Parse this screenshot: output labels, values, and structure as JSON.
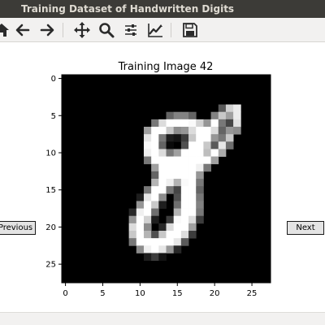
{
  "window": {
    "title": "Training Dataset of Handwritten Digits"
  },
  "toolbar": {
    "buttons": [
      {
        "name": "home-icon"
      },
      {
        "name": "back-arrow-icon"
      },
      {
        "name": "forward-arrow-icon"
      },
      {
        "name": "pan-move-icon"
      },
      {
        "name": "zoom-magnifier-icon"
      },
      {
        "name": "subplots-config-icon"
      },
      {
        "name": "edit-axes-icon"
      },
      {
        "name": "save-icon"
      }
    ]
  },
  "navigation": {
    "previous_label": "Previous",
    "next_label": "Next"
  },
  "chart_data": {
    "type": "heatmap",
    "title": "Training Image 42",
    "colormap": "gray",
    "x_ticks": [
      0,
      5,
      10,
      15,
      20,
      25
    ],
    "y_ticks": [
      0,
      5,
      10,
      15,
      20,
      25
    ],
    "xlim": [
      -0.5,
      27.5
    ],
    "ylim": [
      27.5,
      -0.5
    ],
    "grid": false,
    "pixels": [
      [
        0,
        0,
        0,
        0,
        0,
        0,
        0,
        0,
        0,
        0,
        0,
        0,
        0,
        0,
        0,
        0,
        0,
        0,
        0,
        0,
        0,
        0,
        0,
        0,
        0,
        0,
        0,
        0
      ],
      [
        0,
        0,
        0,
        0,
        0,
        0,
        0,
        0,
        0,
        0,
        0,
        0,
        0,
        0,
        0,
        0,
        0,
        0,
        0,
        0,
        0,
        0,
        0,
        0,
        0,
        0,
        0,
        0
      ],
      [
        0,
        0,
        0,
        0,
        0,
        0,
        0,
        0,
        0,
        0,
        0,
        0,
        0,
        0,
        0,
        0,
        0,
        0,
        0,
        0,
        0,
        0,
        0,
        0,
        0,
        0,
        0,
        0
      ],
      [
        0,
        0,
        0,
        0,
        0,
        0,
        0,
        0,
        0,
        0,
        0,
        0,
        0,
        0,
        0,
        0,
        0,
        0,
        0,
        0,
        0,
        0,
        0,
        0,
        0,
        0,
        0,
        0
      ],
      [
        0,
        0,
        0,
        0,
        0,
        0,
        0,
        0,
        0,
        0,
        0,
        0,
        0,
        0,
        0,
        0,
        0,
        0,
        0,
        0,
        0,
        90,
        210,
        235,
        0,
        0,
        0,
        0
      ],
      [
        0,
        0,
        0,
        0,
        0,
        0,
        0,
        0,
        0,
        0,
        0,
        0,
        0,
        0,
        100,
        130,
        130,
        100,
        0,
        0,
        130,
        200,
        160,
        235,
        0,
        0,
        0,
        0
      ],
      [
        0,
        0,
        0,
        0,
        0,
        0,
        0,
        0,
        0,
        0,
        0,
        0,
        120,
        220,
        255,
        255,
        255,
        250,
        210,
        150,
        255,
        120,
        70,
        225,
        0,
        0,
        0,
        0
      ],
      [
        0,
        0,
        0,
        0,
        0,
        0,
        0,
        0,
        0,
        0,
        0,
        160,
        255,
        255,
        200,
        140,
        150,
        220,
        255,
        255,
        220,
        100,
        150,
        140,
        0,
        0,
        0,
        0
      ],
      [
        0,
        0,
        0,
        0,
        0,
        0,
        0,
        0,
        0,
        0,
        0,
        230,
        255,
        120,
        30,
        20,
        60,
        200,
        255,
        255,
        150,
        120,
        200,
        0,
        0,
        0,
        0,
        0
      ],
      [
        0,
        0,
        0,
        0,
        0,
        0,
        0,
        0,
        0,
        0,
        0,
        250,
        255,
        100,
        10,
        0,
        80,
        255,
        255,
        200,
        90,
        230,
        110,
        0,
        0,
        0,
        0,
        0
      ],
      [
        0,
        0,
        0,
        0,
        0,
        0,
        0,
        0,
        0,
        0,
        0,
        240,
        255,
        220,
        120,
        160,
        255,
        255,
        255,
        190,
        255,
        170,
        0,
        0,
        0,
        0,
        0,
        0
      ],
      [
        0,
        0,
        0,
        0,
        0,
        0,
        0,
        0,
        0,
        0,
        0,
        120,
        255,
        255,
        255,
        255,
        255,
        255,
        255,
        255,
        160,
        0,
        0,
        0,
        0,
        0,
        0,
        0
      ],
      [
        0,
        0,
        0,
        0,
        0,
        0,
        0,
        0,
        0,
        0,
        0,
        0,
        160,
        255,
        255,
        255,
        255,
        255,
        240,
        120,
        0,
        0,
        0,
        0,
        0,
        0,
        0,
        0
      ],
      [
        0,
        0,
        0,
        0,
        0,
        0,
        0,
        0,
        0,
        0,
        0,
        0,
        100,
        255,
        255,
        255,
        255,
        255,
        150,
        0,
        0,
        0,
        0,
        0,
        0,
        0,
        0,
        0
      ],
      [
        0,
        0,
        0,
        0,
        0,
        0,
        0,
        0,
        0,
        0,
        0,
        0,
        180,
        255,
        240,
        180,
        250,
        255,
        120,
        0,
        0,
        0,
        0,
        0,
        0,
        0,
        0,
        0
      ],
      [
        0,
        0,
        0,
        0,
        0,
        0,
        0,
        0,
        0,
        0,
        0,
        120,
        255,
        255,
        120,
        70,
        255,
        255,
        100,
        0,
        0,
        0,
        0,
        0,
        0,
        0,
        0,
        0
      ],
      [
        0,
        0,
        0,
        0,
        0,
        0,
        0,
        0,
        0,
        0,
        30,
        230,
        255,
        140,
        0,
        80,
        255,
        255,
        120,
        0,
        0,
        0,
        0,
        0,
        0,
        0,
        0,
        0
      ],
      [
        0,
        0,
        0,
        0,
        0,
        0,
        0,
        0,
        0,
        0,
        150,
        255,
        200,
        30,
        0,
        110,
        255,
        255,
        130,
        0,
        0,
        0,
        0,
        0,
        0,
        0,
        0,
        0
      ],
      [
        0,
        0,
        0,
        0,
        0,
        0,
        0,
        0,
        0,
        40,
        240,
        255,
        110,
        0,
        0,
        180,
        255,
        255,
        120,
        0,
        0,
        0,
        0,
        0,
        0,
        0,
        0,
        0
      ],
      [
        0,
        0,
        0,
        0,
        0,
        0,
        0,
        0,
        0,
        150,
        255,
        210,
        30,
        0,
        60,
        250,
        255,
        220,
        60,
        0,
        0,
        0,
        0,
        0,
        0,
        0,
        0,
        0
      ],
      [
        0,
        0,
        0,
        0,
        0,
        0,
        0,
        0,
        0,
        220,
        255,
        140,
        0,
        40,
        220,
        255,
        255,
        160,
        0,
        0,
        0,
        0,
        0,
        0,
        0,
        0,
        0,
        0
      ],
      [
        0,
        0,
        0,
        0,
        0,
        0,
        0,
        0,
        0,
        200,
        255,
        180,
        80,
        200,
        255,
        255,
        220,
        60,
        0,
        0,
        0,
        0,
        0,
        0,
        0,
        0,
        0,
        0
      ],
      [
        0,
        0,
        0,
        0,
        0,
        0,
        0,
        0,
        0,
        120,
        255,
        255,
        255,
        255,
        255,
        230,
        90,
        0,
        0,
        0,
        0,
        0,
        0,
        0,
        0,
        0,
        0,
        0
      ],
      [
        0,
        0,
        0,
        0,
        0,
        0,
        0,
        0,
        0,
        0,
        140,
        240,
        255,
        230,
        150,
        40,
        0,
        0,
        0,
        0,
        0,
        0,
        0,
        0,
        0,
        0,
        0,
        0
      ],
      [
        0,
        0,
        0,
        0,
        0,
        0,
        0,
        0,
        0,
        0,
        0,
        30,
        60,
        20,
        0,
        0,
        0,
        0,
        0,
        0,
        0,
        0,
        0,
        0,
        0,
        0,
        0,
        0
      ],
      [
        0,
        0,
        0,
        0,
        0,
        0,
        0,
        0,
        0,
        0,
        0,
        0,
        0,
        0,
        0,
        0,
        0,
        0,
        0,
        0,
        0,
        0,
        0,
        0,
        0,
        0,
        0,
        0
      ],
      [
        0,
        0,
        0,
        0,
        0,
        0,
        0,
        0,
        0,
        0,
        0,
        0,
        0,
        0,
        0,
        0,
        0,
        0,
        0,
        0,
        0,
        0,
        0,
        0,
        0,
        0,
        0,
        0
      ],
      [
        0,
        0,
        0,
        0,
        0,
        0,
        0,
        0,
        0,
        0,
        0,
        0,
        0,
        0,
        0,
        0,
        0,
        0,
        0,
        0,
        0,
        0,
        0,
        0,
        0,
        0,
        0,
        0
      ]
    ]
  }
}
